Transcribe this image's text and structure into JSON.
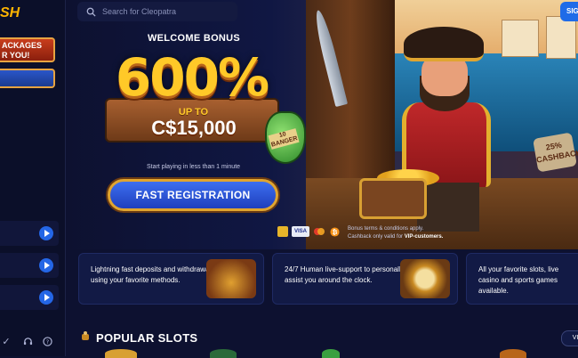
{
  "sidebar": {
    "logo_fragment": "SH",
    "promo_banner": "ACKAGES\nR YOU!",
    "rows": [
      {},
      {},
      {}
    ],
    "bottom_icons": [
      "check-icon",
      "headset-icon",
      "help-icon"
    ]
  },
  "header": {
    "search_placeholder": "Search for Cleopatra",
    "signin_label": "SIG"
  },
  "hero": {
    "welcome": "WELCOME BONUS",
    "percent": "600%",
    "up_to": "UP TO",
    "amount": "C$15,000",
    "bottle_label": "10 BANGER",
    "cashback_tag": "25% CASHBACK",
    "start_text": "Start playing in less than 1 minute",
    "cta_label": "FAST REGISTRATION",
    "payments": [
      "VISA",
      "MC",
      "BTC"
    ],
    "terms_line1": "Bonus terms & conditions apply.",
    "terms_line2": "Cashback only valid for",
    "terms_highlight": "VIP-customers."
  },
  "features": [
    {
      "text": "Lightning fast deposits and withdrawals using your favorite methods.",
      "icon": "treasure-chest-icon"
    },
    {
      "text": "24/7 Human live-support to personally assist you around the clock.",
      "icon": "compass-icon"
    },
    {
      "text": "All your favorite slots, live casino and sports games available.",
      "icon": "slots-icon"
    }
  ],
  "popular": {
    "title": "POPULAR SLOTS",
    "view_all": "VI"
  },
  "colors": {
    "background": "#0d1130",
    "accent_blue": "#1f6be8",
    "gold": "#ffc928"
  }
}
